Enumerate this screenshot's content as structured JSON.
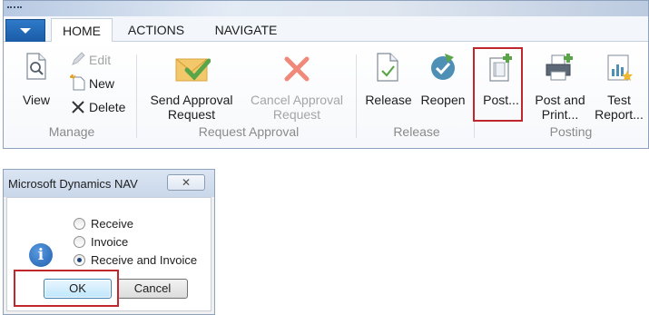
{
  "ribbon": {
    "tabs": [
      "HOME",
      "ACTIONS",
      "NAVIGATE"
    ],
    "active_tab": "HOME",
    "groups": {
      "manage": {
        "label": "Manage",
        "view": "View",
        "edit": "Edit",
        "new": "New",
        "delete": "Delete"
      },
      "request_approval": {
        "label": "Request Approval",
        "send_line1": "Send Approval",
        "send_line2": "Request",
        "cancel_line1": "Cancel Approval",
        "cancel_line2": "Request"
      },
      "release": {
        "label": "Release",
        "release": "Release",
        "reopen": "Reopen"
      },
      "posting": {
        "label": "Posting",
        "post": "Post...",
        "post_print_line1": "Post and",
        "post_print_line2": "Print...",
        "test_line1": "Test",
        "test_line2": "Report..."
      }
    },
    "colors": {
      "accent": "#1a5ba6",
      "highlight": "#c0272d",
      "green": "#5aa54a"
    }
  },
  "dialog": {
    "title": "Microsoft Dynamics NAV",
    "close_glyph": "✕",
    "icon": "info-icon",
    "options": [
      {
        "label": "Receive",
        "checked": false
      },
      {
        "label": "Invoice",
        "checked": false
      },
      {
        "label": "Receive and Invoice",
        "checked": true
      }
    ],
    "ok_label": "OK",
    "cancel_label": "Cancel"
  }
}
